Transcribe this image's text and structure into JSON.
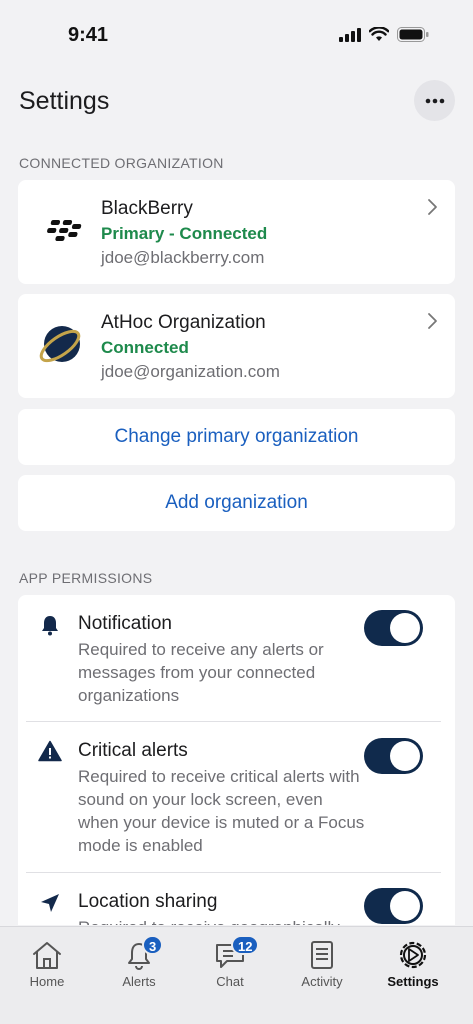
{
  "status_bar": {
    "time": "9:41"
  },
  "header": {
    "title": "Settings",
    "more_icon": "ellipsis-icon"
  },
  "connected_section": {
    "label": "CONNECTED ORGANIZATION"
  },
  "organizations": [
    {
      "name": "BlackBerry",
      "status": "Primary - Connected",
      "email": "jdoe@blackberry.com",
      "logo": "blackberry-logo"
    },
    {
      "name": "AtHoc Organization",
      "status": "Connected",
      "email": "jdoe@organization.com",
      "logo": "athoc-logo"
    }
  ],
  "actions": {
    "change_primary": "Change primary organization",
    "add_org": "Add organization"
  },
  "permissions_section": {
    "label": "APP PERMISSIONS"
  },
  "permissions": [
    {
      "title": "Notification",
      "description": "Required to receive any alerts or messages from your connected organizations",
      "icon": "bell-icon",
      "enabled": true
    },
    {
      "title": "Critical alerts",
      "description": "Required to receive critical alerts with sound on your lock screen, even when your device is muted or a Focus mode is enabled",
      "icon": "warning-icon",
      "enabled": true
    },
    {
      "title": "Location sharing",
      "description": "Required to receive geographically",
      "icon": "location-arrow-icon",
      "enabled": true
    }
  ],
  "tabs": [
    {
      "label": "Home",
      "icon": "home-icon",
      "badge": ""
    },
    {
      "label": "Alerts",
      "icon": "bell-icon",
      "badge": "3"
    },
    {
      "label": "Chat",
      "icon": "chat-icon",
      "badge": "12"
    },
    {
      "label": "Activity",
      "icon": "activity-icon",
      "badge": ""
    },
    {
      "label": "Settings",
      "icon": "settings-icon",
      "badge": ""
    }
  ],
  "colors": {
    "accent": "#1a5fbf",
    "connected_green": "#1e8a4c",
    "toggle_on": "#102a4c",
    "background": "#f2f2f4"
  }
}
